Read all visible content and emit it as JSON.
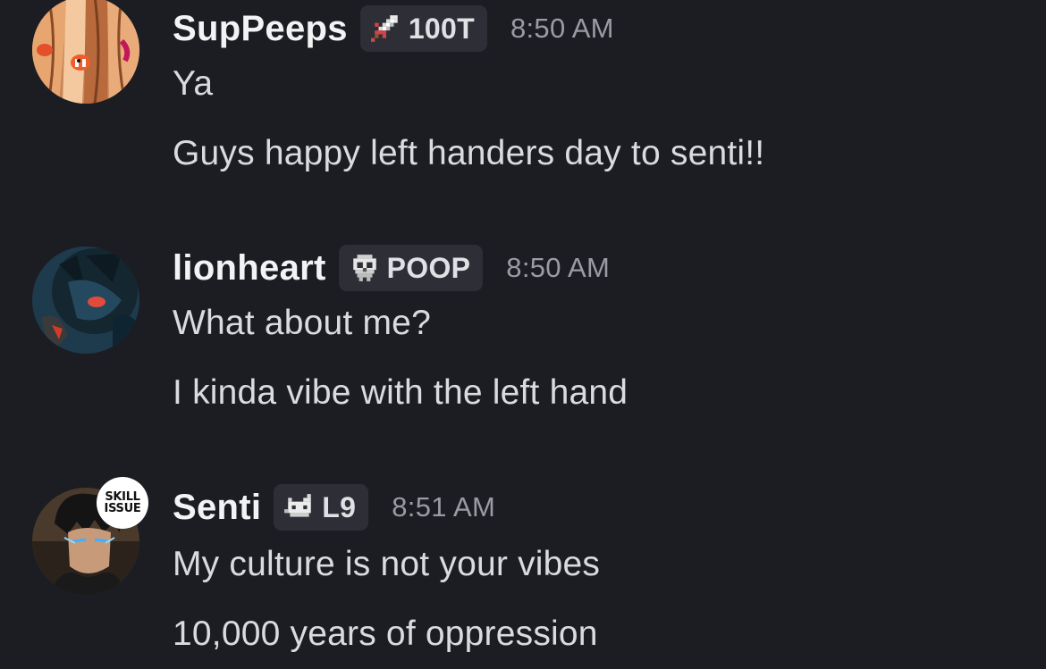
{
  "messages": [
    {
      "username": "SupPeeps",
      "tag": {
        "icon": "sword-icon",
        "text": "100T"
      },
      "timestamp": "8:50 AM",
      "lines": [
        "Ya",
        "Guys happy left handers day to senti!!"
      ]
    },
    {
      "username": "lionheart",
      "tag": {
        "icon": "skull-icon",
        "text": "POOP"
      },
      "timestamp": "8:50 AM",
      "lines": [
        "What about me?",
        "I kinda vibe with the left hand"
      ]
    },
    {
      "username": "Senti",
      "tag": {
        "icon": "cat-icon",
        "text": "L9"
      },
      "timestamp": "8:51 AM",
      "avatar_decoration": {
        "line1": "SKILL",
        "line2": "ISSUE"
      },
      "lines": [
        "My culture is not your vibes",
        "10,000 years of oppression"
      ]
    }
  ],
  "colors": {
    "background": "#1c1d22",
    "tag_background": "#2e2f36",
    "username": "#f2f3f5",
    "message_text": "#d9dbdf",
    "timestamp": "#9a9ca3"
  }
}
